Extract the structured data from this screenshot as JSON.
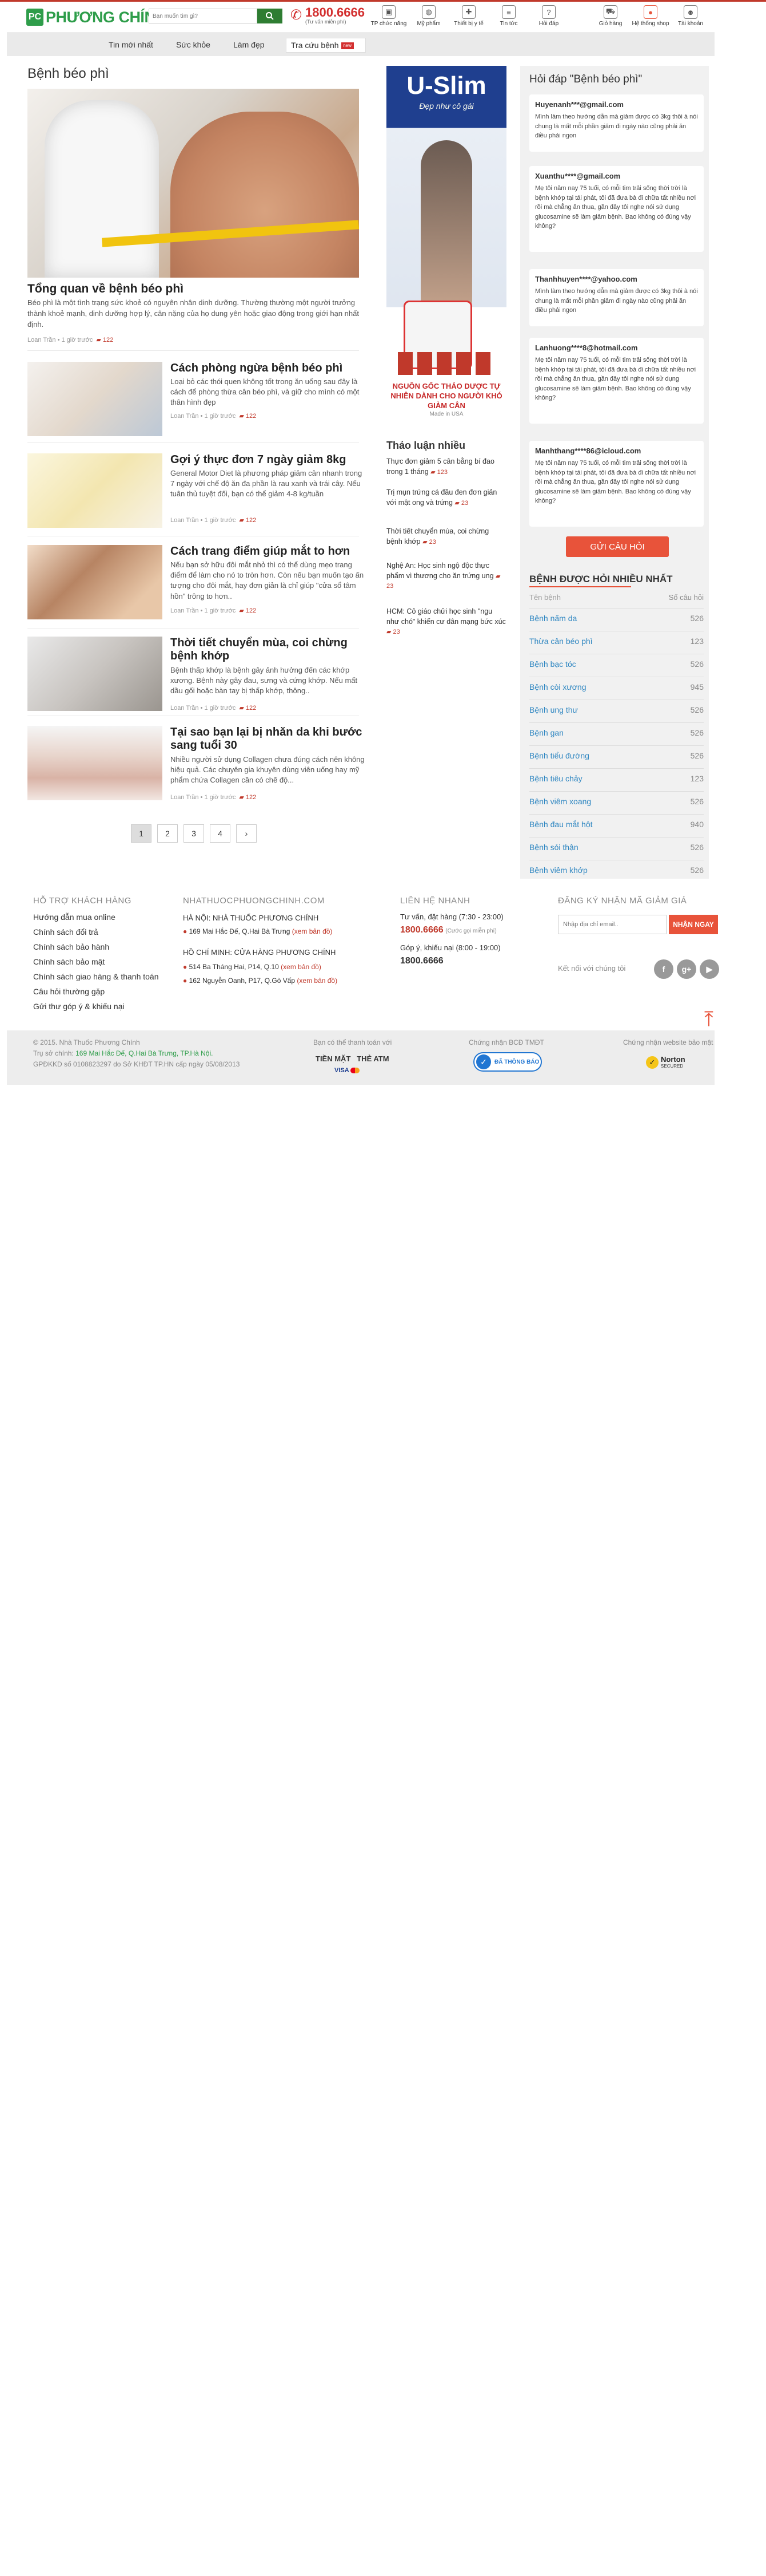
{
  "header": {
    "logo_mark": "PC",
    "logo_text": "PHƯƠNG CHÍNH",
    "search_placeholder": "Bạn muốn tìm gì?",
    "hotline": "1800.6666",
    "hotline_sub": "(Tư vấn miễn phí)",
    "nav": [
      {
        "label": "TP chức năng",
        "icon": "box-icon"
      },
      {
        "label": "Mỹ phẩm",
        "icon": "cosmetics-icon"
      },
      {
        "label": "Thiết bị y tế",
        "icon": "medical-device-icon"
      },
      {
        "label": "Tin tức",
        "icon": "news-icon"
      },
      {
        "label": "Hỏi đáp",
        "icon": "question-icon"
      },
      {
        "label": "Giỏ hàng",
        "icon": "cart-icon"
      },
      {
        "label": "Hệ thống shop",
        "icon": "map-pin-icon"
      },
      {
        "label": "Tài khoản",
        "icon": "user-icon"
      }
    ]
  },
  "menu": {
    "items": [
      "Tin mới nhất",
      "Sức khỏe",
      "Làm đẹp"
    ],
    "active": "Tra cứu bệnh",
    "flag_text": "new"
  },
  "main": {
    "page_title": "Bệnh béo phì",
    "hero": {
      "title": "Tổng quan về bệnh béo phì",
      "desc": "Béo phì là một tình trạng sức khoẻ có nguyên nhân dinh dưỡng. Thường thường một người trưởng thành khoẻ mạnh, dinh dưỡng hợp lý, cân nặng của họ dung yên hoặc giao động trong giới hạn nhất định.",
      "author": "Loan Trần",
      "time": "1 giờ trước",
      "comments": "122"
    },
    "articles": [
      {
        "title": "Cách phòng ngừa bệnh béo phì",
        "desc": "Loại bỏ các thói quen không tốt trong ăn uống sau đây là cách để phòng thừa cân béo phì, và giữ cho mình có một thân hình đẹp",
        "author": "Loan Trần",
        "time": "1 giờ trước",
        "comments": "122"
      },
      {
        "title": "Gợi ý thực đơn 7 ngày giảm 8kg",
        "desc": "General Motor Diet là phương pháp giảm cân nhanh trong 7 ngày với chế độ ăn đa phần là rau xanh và trái cây. Nếu tuân thủ tuyệt đối, bạn có thể giảm 4-8 kg/tuần",
        "author": "Loan Trần",
        "time": "1 giờ trước",
        "comments": "122"
      },
      {
        "title": "Cách trang điểm giúp mắt to hơn",
        "desc": "Nếu bạn sở hữu đôi mắt nhỏ thì có thể dùng mẹo trang điểm để làm cho nó to tròn hơn. Còn nếu bạn muốn tạo ấn tượng cho đôi mắt, hay đơn giản là chỉ giúp \"cửa sổ tâm hồn\" trông to hơn..",
        "author": "Loan Trần",
        "time": "1 giờ trước",
        "comments": "122"
      },
      {
        "title": "Thời tiết chuyển mùa, coi chừng bệnh khớp",
        "desc": "Bệnh thấp khớp là bệnh gây ảnh hưởng đến các khớp xương. Bệnh này gây đau, sưng và cứng khớp. Nếu mất dầu gối hoặc bàn tay bị thấp khớp, thông..",
        "author": "Loan Trần",
        "time": "1 giờ trước",
        "comments": "122"
      },
      {
        "title": "Tại sao bạn lại bị nhăn da khi bước sang tuổi 30",
        "desc": "Nhiều người sử dụng Collagen chưa đúng cách nên không hiệu quả. Các chuyên gia khuyên dùng viên uống hay mỹ phẩm chứa Collagen cần có chế độ...",
        "author": "Loan Trần",
        "time": "1 giờ trước",
        "comments": "122"
      }
    ],
    "pagination": [
      "1",
      "2",
      "3",
      "4",
      "›"
    ]
  },
  "ad": {
    "title": "U-Slim",
    "subtitle": "Đẹp như cô gái",
    "footer": "NGUỒN GỐC THẢO DƯỢC TỰ NHIÊN DÀNH CHO NGƯỜI KHÓ GIẢM CÂN",
    "made_in": "Made in USA"
  },
  "discussion": {
    "title": "Thảo luận nhiều",
    "items": [
      {
        "text": "Thực đơn giảm 5 cân bằng bí đao trong 1 tháng",
        "comments": "123"
      },
      {
        "text": "Trị mụn trứng cá đầu đen đơn giản với mật ong và trứng",
        "comments": "23"
      },
      {
        "text": "Thời tiết chuyển mùa, coi chừng bệnh khớp",
        "comments": "23"
      },
      {
        "text": "Nghệ An: Học sinh ngộ độc thực phẩm vì thương cho ăn trứng ung",
        "comments": "23"
      },
      {
        "text": "HCM: Cô giáo chửi học sinh \"ngu như chó\" khiến cư dân mạng bức xúc",
        "comments": "23"
      }
    ]
  },
  "qa": {
    "title": "Hỏi đáp \"Bệnh béo phì\"",
    "cards": [
      {
        "email": "Huyenanh***@gmail.com",
        "text": "Mình làm theo hướng dẫn mà giảm được có 3kg thôi à nói chung là mất mỗi phần giảm đi ngày nào cũng phải ăn điều phải ngon"
      },
      {
        "email": "Xuanthu****@gmail.com",
        "text": "Mẹ tôi năm nay 75 tuổi, có mỗi tim trải sống thời trời là bệnh khớp tại tái phát, tôi đã đưa bà đi chữa tất nhiều nơi rồi mà chẳng ăn thua, gần đây tôi nghe nói sử dụng glucosamine sẽ làm giảm bệnh. Bao không có đúng vậy không?"
      },
      {
        "email": "Thanhhuyen****@yahoo.com",
        "text": "Mình làm theo hướng dẫn mà giảm được có 3kg thôi à nói chung là mất mỗi phần giảm đi ngày nào cũng phải ăn điều phải ngon"
      },
      {
        "email": "Lanhuong****8@hotmail.com",
        "text": "Mẹ tôi năm nay 75 tuổi, có mỗi tim trải sống thời trời là bệnh khớp tại tái phát, tôi đã đưa bà đi chữa tất nhiều nơi rồi mà chẳng ăn thua, gần đây tôi nghe nói sử dụng glucosamine sẽ làm giảm bệnh. Bao không có đúng vậy không?"
      },
      {
        "email": "Manhthang****86@icloud.com",
        "text": "Mẹ tôi năm nay 75 tuổi, có mỗi tim trải sống thời trời là bệnh khớp tại tái phát, tôi đã đưa bà đi chữa tất nhiều nơi rồi mà chẳng ăn thua, gần đây tôi nghe nói sử dụng glucosamine sẽ làm giảm bệnh. Bao không có đúng vậy không?"
      }
    ],
    "ask_button": "GỬI CÂU HỎI"
  },
  "top_diseases": {
    "title": "BỆNH ĐƯỢC HỎI NHIỀU NHẤT",
    "col_name": "Tên bệnh",
    "col_count": "Số câu hỏi",
    "rows": [
      {
        "name": "Bệnh nấm da",
        "count": "526"
      },
      {
        "name": "Thừa cân béo phì",
        "count": "123"
      },
      {
        "name": "Bệnh bạc tóc",
        "count": "526"
      },
      {
        "name": "Bệnh còi xương",
        "count": "945"
      },
      {
        "name": "Bệnh ung thư",
        "count": "526"
      },
      {
        "name": "Bệnh gan",
        "count": "526"
      },
      {
        "name": "Bệnh tiểu đường",
        "count": "526"
      },
      {
        "name": "Bệnh tiêu chảy",
        "count": "123"
      },
      {
        "name": "Bệnh viêm xoang",
        "count": "526"
      },
      {
        "name": "Bệnh đau mắt hột",
        "count": "940"
      },
      {
        "name": "Bệnh sỏi thận",
        "count": "526"
      },
      {
        "name": "Bệnh viêm khớp",
        "count": "526"
      }
    ]
  },
  "footer": {
    "support_title": "HỖ TRỢ KHÁCH HÀNG",
    "support_links": [
      "Hướng dẫn mua online",
      "Chính sách đổi trả",
      "Chính sách bảo hành",
      "Chính sách bảo mật",
      "Chính sách giao hàng & thanh toán",
      "Câu hỏi thường gặp",
      "Gửi thư góp ý & khiếu nại"
    ],
    "stores_title": "NHATHUOCPHUONGCHINH.COM",
    "hn_title": "HÀ NỘI: NHÀ THUỐC PHƯƠNG CHÍNH",
    "hn_addr": "169 Mai Hắc Đế, Q.Hai Bà Trưng",
    "map_link": "(xem bản đồ)",
    "hcm_title": "HỒ CHÍ MINH: CỬA HÀNG PHƯƠNG CHÍNH",
    "hcm_addr1": "514 Ba Tháng Hai, P14, Q.10",
    "hcm_addr2": "162 Nguyễn Oanh, P17, Q.Gò Vấp",
    "contact_title": "LIÊN HỆ NHANH",
    "advice_label": "Tư vấn, đặt hàng (7:30 - 23:00)",
    "advice_num": "1800.6666",
    "advice_note": "(Cước gọi miễn phí)",
    "complaint_label": "Góp ý, khiếu nại (8:00 - 19:00)",
    "complaint_num": "1800.6666",
    "news_title": "ĐĂNG KÝ NHẬN MÃ GIẢM GIÁ",
    "news_placeholder": "Nhập địa chỉ email..",
    "news_button": "NHẬN NGAY",
    "social_label": "Kết nối với chúng tôi",
    "social": [
      "f",
      "g+",
      "▶"
    ]
  },
  "bottom": {
    "copyright": "© 2015. Nhà Thuốc Phương Chính",
    "hq_label": "Trụ sở chính:",
    "hq_addr": "169 Mai Hắc Đế, Q.Hai Bà Trưng, TP.Hà Nội.",
    "license": "GPĐKKD số 0108823297 do Sở KHĐT TP.HN cấp ngày 05/08/2013",
    "pay_title": "Bạn có thể thanh toán với",
    "pay_cash": "TIỀN MẶT",
    "pay_atm": "THẺ ATM",
    "pay_visa": "VISA",
    "bct_title": "Chứng nhận BCĐ TMĐT",
    "bct_badge": "ĐÃ THÔNG BÁO",
    "norton_title": "Chứng nhận website bảo mật",
    "norton_badge": "Norton",
    "norton_sub": "SECURED"
  }
}
